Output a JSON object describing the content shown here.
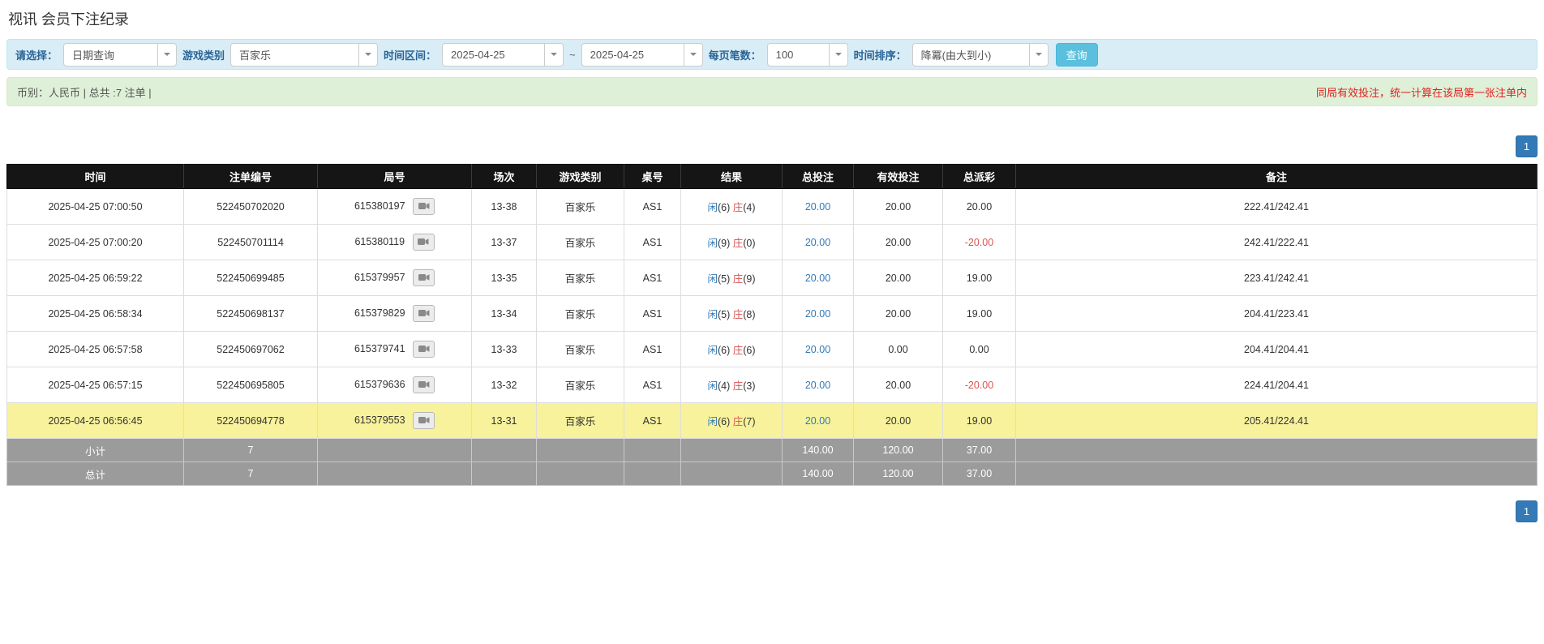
{
  "page": {
    "title": "视讯 会员下注纪录"
  },
  "colors": {
    "accent_blue": "#337ab7",
    "negative_red": "#d9534f",
    "highlight_yellow": "#f7f29b",
    "header_black": "#151515",
    "footer_gray": "#9b9b9b",
    "filter_bar_bg": "#d9edf7",
    "summary_bar_bg": "#dff0d8"
  },
  "filters": {
    "select_label": "请选择：",
    "select_value": "日期查询",
    "game_type_label": "游戏类别",
    "game_type_value": "百家乐",
    "time_range_label": "时间区间：",
    "date_from": "2025-04-25",
    "tilde": "~",
    "date_to": "2025-04-25",
    "page_size_label": "每页笔数：",
    "page_size_value": "100",
    "sort_label": "时间排序：",
    "sort_value": "降冪(由大到小)",
    "search_button": "查询"
  },
  "summary": {
    "left": "币别：人民币 | 总共 :7 注单 |",
    "right": "同局有效投注，统一计算在该局第一张注单内"
  },
  "pagination": {
    "page": "1"
  },
  "table": {
    "headers": [
      "时间",
      "注单编号",
      "局号",
      "场次",
      "游戏类别",
      "桌号",
      "结果",
      "总投注",
      "有效投注",
      "总派彩",
      "备注"
    ],
    "rows": [
      {
        "time": "2025-04-25 07:00:50",
        "bet_id": "522450702020",
        "round_id": "615380197",
        "session": "13-38",
        "game": "百家乐",
        "table_no": "AS1",
        "player": "闲",
        "player_score": "(6)",
        "banker": "庄",
        "banker_score": "(4)",
        "total_bet": "20.00",
        "valid_bet": "20.00",
        "payout": "20.00",
        "note": "222.41/242.41",
        "highlight": false
      },
      {
        "time": "2025-04-25 07:00:20",
        "bet_id": "522450701114",
        "round_id": "615380119",
        "session": "13-37",
        "game": "百家乐",
        "table_no": "AS1",
        "player": "闲",
        "player_score": "(9)",
        "banker": "庄",
        "banker_score": "(0)",
        "total_bet": "20.00",
        "valid_bet": "20.00",
        "payout": "-20.00",
        "note": "242.41/222.41",
        "highlight": false
      },
      {
        "time": "2025-04-25 06:59:22",
        "bet_id": "522450699485",
        "round_id": "615379957",
        "session": "13-35",
        "game": "百家乐",
        "table_no": "AS1",
        "player": "闲",
        "player_score": "(5)",
        "banker": "庄",
        "banker_score": "(9)",
        "total_bet": "20.00",
        "valid_bet": "20.00",
        "payout": "19.00",
        "note": "223.41/242.41",
        "highlight": false
      },
      {
        "time": "2025-04-25 06:58:34",
        "bet_id": "522450698137",
        "round_id": "615379829",
        "session": "13-34",
        "game": "百家乐",
        "table_no": "AS1",
        "player": "闲",
        "player_score": "(5)",
        "banker": "庄",
        "banker_score": "(8)",
        "total_bet": "20.00",
        "valid_bet": "20.00",
        "payout": "19.00",
        "note": "204.41/223.41",
        "highlight": false
      },
      {
        "time": "2025-04-25 06:57:58",
        "bet_id": "522450697062",
        "round_id": "615379741",
        "session": "13-33",
        "game": "百家乐",
        "table_no": "AS1",
        "player": "闲",
        "player_score": "(6)",
        "banker": "庄",
        "banker_score": "(6)",
        "total_bet": "20.00",
        "valid_bet": "0.00",
        "payout": "0.00",
        "note": "204.41/204.41",
        "highlight": false
      },
      {
        "time": "2025-04-25 06:57:15",
        "bet_id": "522450695805",
        "round_id": "615379636",
        "session": "13-32",
        "game": "百家乐",
        "table_no": "AS1",
        "player": "闲",
        "player_score": "(4)",
        "banker": "庄",
        "banker_score": "(3)",
        "total_bet": "20.00",
        "valid_bet": "20.00",
        "payout": "-20.00",
        "note": "224.41/204.41",
        "highlight": false
      },
      {
        "time": "2025-04-25 06:56:45",
        "bet_id": "522450694778",
        "round_id": "615379553",
        "session": "13-31",
        "game": "百家乐",
        "table_no": "AS1",
        "player": "闲",
        "player_score": "(6)",
        "banker": "庄",
        "banker_score": "(7)",
        "total_bet": "20.00",
        "valid_bet": "20.00",
        "payout": "19.00",
        "note": "205.41/224.41",
        "highlight": true
      }
    ],
    "subtotal": {
      "label": "小计",
      "count": "7",
      "total_bet": "140.00",
      "valid_bet": "120.00",
      "payout": "37.00"
    },
    "total": {
      "label": "总计",
      "count": "7",
      "total_bet": "140.00",
      "valid_bet": "120.00",
      "payout": "37.00"
    }
  }
}
